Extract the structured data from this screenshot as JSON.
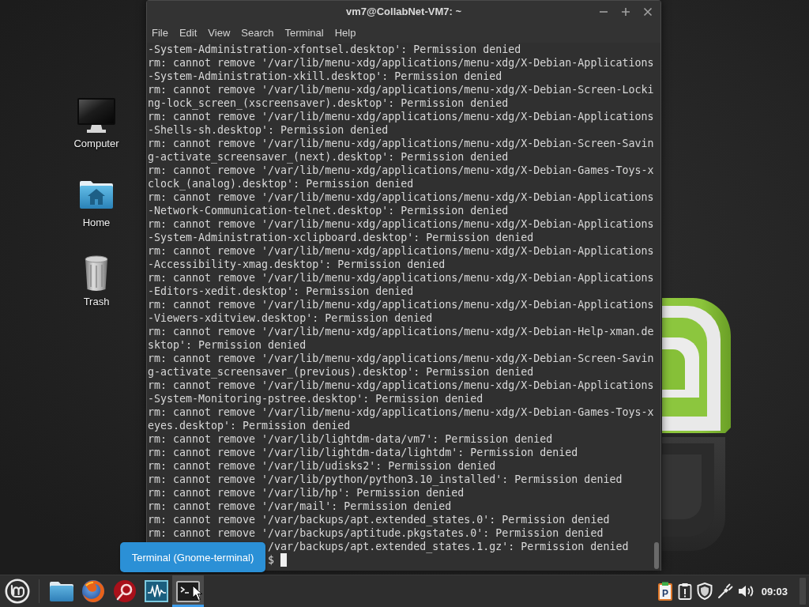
{
  "desktop_icons": [
    {
      "label": "Computer",
      "kind": "computer"
    },
    {
      "label": "Home",
      "kind": "home"
    },
    {
      "label": "Trash",
      "kind": "trash"
    }
  ],
  "window": {
    "title": "vm7@CollabNet-VM7: ~",
    "menu": [
      "File",
      "Edit",
      "View",
      "Search",
      "Terminal",
      "Help"
    ],
    "lines": [
      "-System-Administration-xfontsel.desktop': Permission denied",
      "rm: cannot remove '/var/lib/menu-xdg/applications/menu-xdg/X-Debian-Applications",
      "-System-Administration-xkill.desktop': Permission denied",
      "rm: cannot remove '/var/lib/menu-xdg/applications/menu-xdg/X-Debian-Screen-Locki",
      "ng-lock_screen_(xscreensaver).desktop': Permission denied",
      "rm: cannot remove '/var/lib/menu-xdg/applications/menu-xdg/X-Debian-Applications",
      "-Shells-sh.desktop': Permission denied",
      "rm: cannot remove '/var/lib/menu-xdg/applications/menu-xdg/X-Debian-Screen-Savin",
      "g-activate_screensaver_(next).desktop': Permission denied",
      "rm: cannot remove '/var/lib/menu-xdg/applications/menu-xdg/X-Debian-Games-Toys-x",
      "clock_(analog).desktop': Permission denied",
      "rm: cannot remove '/var/lib/menu-xdg/applications/menu-xdg/X-Debian-Applications",
      "-Network-Communication-telnet.desktop': Permission denied",
      "rm: cannot remove '/var/lib/menu-xdg/applications/menu-xdg/X-Debian-Applications",
      "-System-Administration-xclipboard.desktop': Permission denied",
      "rm: cannot remove '/var/lib/menu-xdg/applications/menu-xdg/X-Debian-Applications",
      "-Accessibility-xmag.desktop': Permission denied",
      "rm: cannot remove '/var/lib/menu-xdg/applications/menu-xdg/X-Debian-Applications",
      "-Editors-xedit.desktop': Permission denied",
      "rm: cannot remove '/var/lib/menu-xdg/applications/menu-xdg/X-Debian-Applications",
      "-Viewers-xditview.desktop': Permission denied",
      "rm: cannot remove '/var/lib/menu-xdg/applications/menu-xdg/X-Debian-Help-xman.de",
      "sktop': Permission denied",
      "rm: cannot remove '/var/lib/menu-xdg/applications/menu-xdg/X-Debian-Screen-Savin",
      "g-activate_screensaver_(previous).desktop': Permission denied",
      "rm: cannot remove '/var/lib/menu-xdg/applications/menu-xdg/X-Debian-Applications",
      "-System-Monitoring-pstree.desktop': Permission denied",
      "rm: cannot remove '/var/lib/menu-xdg/applications/menu-xdg/X-Debian-Games-Toys-x",
      "eyes.desktop': Permission denied",
      "rm: cannot remove '/var/lib/lightdm-data/vm7': Permission denied",
      "rm: cannot remove '/var/lib/lightdm-data/lightdm': Permission denied",
      "rm: cannot remove '/var/lib/udisks2': Permission denied",
      "rm: cannot remove '/var/lib/python/python3.10_installed': Permission denied",
      "rm: cannot remove '/var/lib/hp': Permission denied",
      "rm: cannot remove '/var/mail': Permission denied",
      "rm: cannot remove '/var/backups/apt.extended_states.0': Permission denied",
      "rm: cannot remove '/var/backups/aptitude.pkgstates.0': Permission denied"
    ],
    "covered_line": "/var/backups/apt.extended_states.1.gz': Permission denied",
    "prompt": {
      "text": "$",
      "cursor": true
    }
  },
  "tooltip": {
    "text": "Terminal (Gnome-terminal)"
  },
  "taskbar": {
    "launchers": [
      {
        "kind": "folder",
        "active": false
      },
      {
        "kind": "globe",
        "active": false
      },
      {
        "kind": "ring",
        "active": false
      },
      {
        "kind": "waveform",
        "active": false
      },
      {
        "kind": "terminal",
        "active": true
      }
    ],
    "clipboard_letter": "P",
    "clock": "09:03"
  }
}
